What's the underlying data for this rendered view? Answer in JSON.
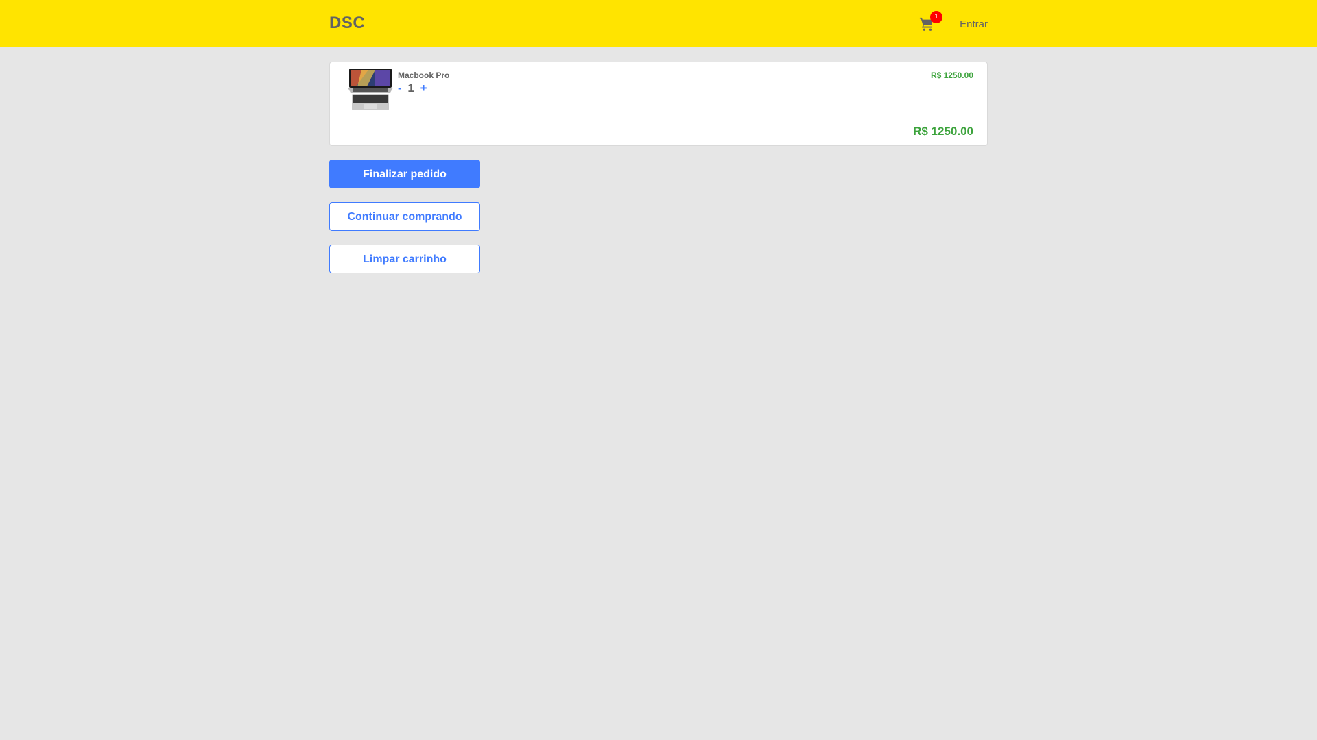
{
  "navbar": {
    "logo": "DSC",
    "cart_count": "1",
    "login_label": "Entrar",
    "background": "#ffe400"
  },
  "cart": {
    "items": [
      {
        "name": "Macbook Pro",
        "quantity": "1",
        "decrease_label": "-",
        "increase_label": "+",
        "price": "R$ 1250.00"
      }
    ],
    "total": "R$ 1250.00"
  },
  "actions": {
    "finalize_label": "Finalizar pedido",
    "continue_label": "Continuar comprando",
    "clear_label": "Limpar carrinho"
  },
  "colors": {
    "accent": "#407bff",
    "price": "#3ca33c",
    "badge": "#ff0000",
    "text": "#636363"
  }
}
